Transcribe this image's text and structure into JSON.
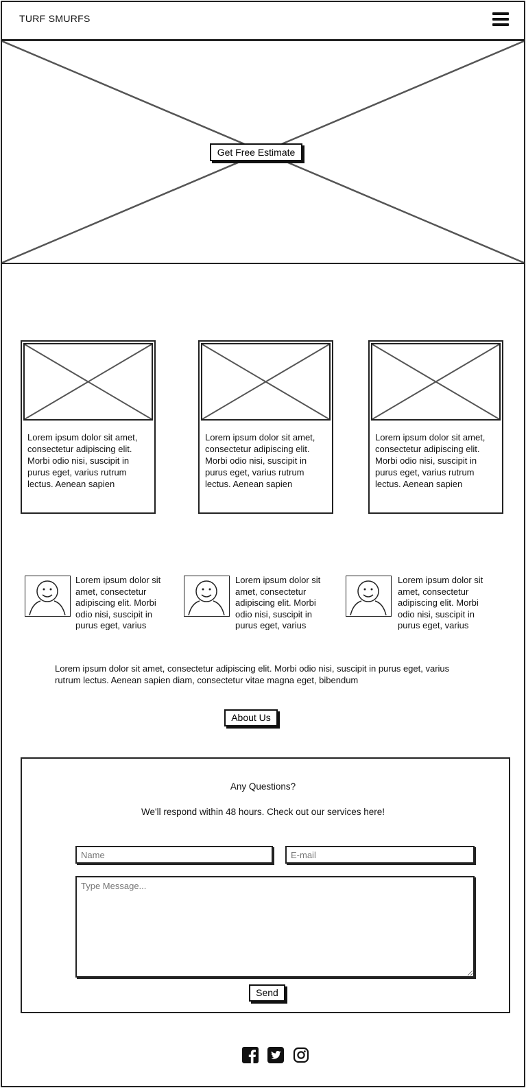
{
  "header": {
    "brand": "TURF SMURFS",
    "menu_icon": "hamburger-menu-icon"
  },
  "hero": {
    "cta_label": "Get Free Estimate",
    "image_icon": "image-placeholder-icon"
  },
  "cards": [
    {
      "text": "Lorem ipsum dolor sit amet, consectetur adipiscing elit. Morbi odio nisi, suscipit in purus eget, varius rutrum lectus. Aenean sapien"
    },
    {
      "text": "Lorem ipsum dolor sit amet, consectetur adipiscing elit. Morbi odio nisi, suscipit in purus eget, varius rutrum lectus. Aenean sapien"
    },
    {
      "text": "Lorem ipsum dolor sit amet, consectetur adipiscing elit. Morbi odio nisi, suscipit in purus eget, varius rutrum lectus. Aenean sapien"
    }
  ],
  "testimonials": [
    {
      "text": "Lorem ipsum dolor sit amet, consectetur adipiscing elit. Morbi odio nisi, suscipit in purus eget, varius",
      "icon": "user-avatar-icon"
    },
    {
      "text": "Lorem ipsum dolor sit amet, consectetur adipiscing elit. Morbi odio nisi, suscipit in purus eget, varius",
      "icon": "user-avatar-icon"
    },
    {
      "text": "Lorem ipsum dolor sit amet, consectetur adipiscing elit. Morbi odio nisi, suscipit in purus eget, varius",
      "icon": "user-avatar-icon"
    }
  ],
  "about": {
    "paragraph": "Lorem ipsum dolor sit amet, consectetur adipiscing elit. Morbi odio nisi, suscipit in purus eget, varius rutrum lectus. Aenean sapien diam, consectetur vitae magna eget, bibendum",
    "button_label": "About Us"
  },
  "contact": {
    "title": "Any Questions?",
    "subtitle": "We'll respond within 48 hours. Check out our services here!",
    "name_placeholder": "Name",
    "email_placeholder": "E-mail",
    "message_placeholder": "Type Message...",
    "send_label": "Send"
  },
  "footer": {
    "social_icons": [
      "facebook-icon",
      "twitter-icon",
      "instagram-icon"
    ]
  }
}
